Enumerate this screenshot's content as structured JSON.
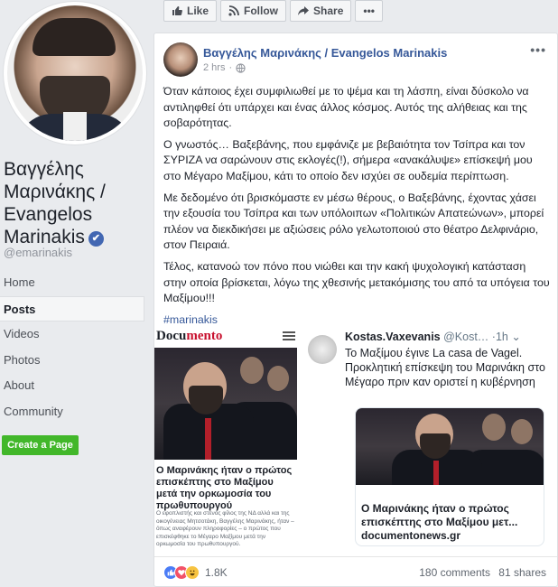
{
  "profile": {
    "name_line1": "Βαγγέλης",
    "name_line2": "Μαρινάκης /",
    "name_line3": "Evangelos",
    "name_line4": "Marinakis",
    "verified_badge": "✔",
    "handle": "@emarinakis"
  },
  "nav": {
    "items": [
      "Home",
      "Posts",
      "Videos",
      "Photos",
      "About",
      "Community"
    ],
    "active": "Posts",
    "create_page": "Create a Page"
  },
  "actions": {
    "like": "Like",
    "follow": "Follow",
    "share": "Share",
    "more": "•••"
  },
  "post": {
    "author": "Βαγγέλης Μαρινάκης / Evangelos Marinakis",
    "time": "2 hrs",
    "dot": "·",
    "more": "•••",
    "paragraphs": [
      "Όταν κάποιος έχει συμφιλιωθεί με το ψέμα και τη λάσπη, είναι δύσκολο να αντιληφθεί ότι υπάρχει και ένας άλλος κόσμος. Αυτός της αλήθειας και της σοβαρότητας.",
      "Ο γνωστός… Βαξεβάνης, που εμφάνιζε με βεβαιότητα τον Τσίπρα και τον ΣΥΡΙΖΑ να σαρώνουν στις εκλογές(!), σήμερα «ανακάλυψε» επίσκεψή μου στο Μέγαρο Μαξίμου, κάτι το οποίο δεν ισχύει σε ουδεμία περίπτωση.",
      "Με δεδομένο ότι βρισκόμαστε εν μέσω θέρους, ο Βαξεβάνης, έχοντας χάσει την εξουσία του Τσίπρα και των υπόλοιπων «Πολιτικών Απατεώνων», μπορεί πλέον να διεκδικήσει με αξιώσεις ρόλο γελωτοποιού στο θέατρο Δελφινάριο, στον Πειραιά.",
      "Τέλος, κατανοώ τον πόνο που νιώθει και την κακή ψυχολογική κατάσταση στην οποία βρίσκεται, λόγω της χθεσινής μετακόμισης του από τα υπόγεια του Μαξίμου!!!"
    ],
    "hashtag": "#marinakis"
  },
  "shared_left": {
    "logo_main": "Docu",
    "logo_accent": "mento",
    "headline": "Ο Μαρινάκης ήταν ο πρώτος επισκέπτης στο Μαξίμου μετά την ορκωμοσία του πρωθυπουργού",
    "subtext": "Ο εφοπλιστής και στενός φίλος της ΝΔ αλλά και της οικογένειας Μητσοτάκη, Βαγγέλης Μαρινάκης, ήταν – όπως αναφέρουν πληροφορίες – ο πρώτος που επισκέφθηκε το Μέγαρο Μαξίμου μετά την ορκωμοσία του πρωθυπουργού."
  },
  "shared_right": {
    "name": "Kostas.Vaxevanis",
    "handle": "@Kost…",
    "time": "·1h",
    "chevron": "⌄",
    "text": "Το Μαξίμου έγινε La casa de Vagel. Προκλητική επίσκεψη του Μαρινάκη στο Μέγαρο πριν καν οριστεί η κυβέρνηση",
    "card_title": "Ο Μαρινάκης ήταν ο πρώτος επισκέπτης στο Μαξίμου μετ...",
    "card_url": "documentonews.gr"
  },
  "footer": {
    "reactions_count": "1.8K",
    "comments": "180 comments",
    "shares": "81 shares"
  }
}
